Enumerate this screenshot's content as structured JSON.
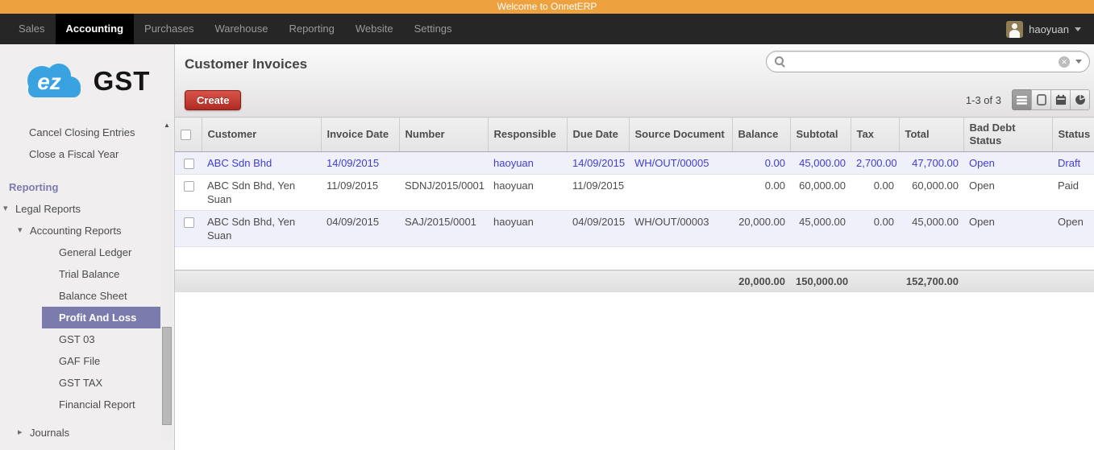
{
  "top_bar": {
    "welcome_text": "Welcome to OnnetERP"
  },
  "nav": {
    "items": [
      {
        "label": "Sales",
        "active": false
      },
      {
        "label": "Accounting",
        "active": true
      },
      {
        "label": "Purchases",
        "active": false
      },
      {
        "label": "Warehouse",
        "active": false
      },
      {
        "label": "Reporting",
        "active": false
      },
      {
        "label": "Website",
        "active": false
      },
      {
        "label": "Settings",
        "active": false
      }
    ],
    "user": {
      "name": "haoyuan"
    }
  },
  "sidebar": {
    "logo": {
      "cloud_text": "ez",
      "brand_text": "GST"
    },
    "items": [
      {
        "label": "Cancel Closing Entries",
        "level": "top",
        "caret": "none",
        "selected": false
      },
      {
        "label": "Close a Fiscal Year",
        "level": "top",
        "caret": "none",
        "selected": false
      },
      {
        "label": "Reporting",
        "level": "section",
        "caret": "none",
        "selected": false
      },
      {
        "label": "Legal Reports",
        "level": "0",
        "caret": "expanded",
        "selected": false
      },
      {
        "label": "Accounting Reports",
        "level": "1",
        "caret": "expanded",
        "selected": false
      },
      {
        "label": "General Ledger",
        "level": "2",
        "caret": "none",
        "selected": false
      },
      {
        "label": "Trial Balance",
        "level": "2",
        "caret": "none",
        "selected": false
      },
      {
        "label": "Balance Sheet",
        "level": "2",
        "caret": "none",
        "selected": false
      },
      {
        "label": "Profit And Loss",
        "level": "2",
        "caret": "none",
        "selected": true
      },
      {
        "label": "GST 03",
        "level": "2",
        "caret": "none",
        "selected": false
      },
      {
        "label": "GAF File",
        "level": "2",
        "caret": "none",
        "selected": false
      },
      {
        "label": "GST TAX",
        "level": "2",
        "caret": "none",
        "selected": false
      },
      {
        "label": "Financial Report",
        "level": "2",
        "caret": "none",
        "selected": false
      },
      {
        "label": "Journals",
        "level": "1",
        "caret": "collapsed",
        "selected": false,
        "gap": true
      }
    ]
  },
  "main": {
    "title": "Customer Invoices",
    "search": {
      "value": "",
      "placeholder": ""
    },
    "create_label": "Create",
    "pagination": "1-3 of 3",
    "view_switcher": [
      {
        "name": "list",
        "active": true
      },
      {
        "name": "form",
        "active": false
      },
      {
        "name": "calendar",
        "active": false
      },
      {
        "name": "graph",
        "active": false
      }
    ],
    "table": {
      "columns": [
        {
          "key": "customer",
          "label": "Customer",
          "numeric": false
        },
        {
          "key": "invoice_date",
          "label": "Invoice Date",
          "numeric": false
        },
        {
          "key": "number",
          "label": "Number",
          "numeric": false
        },
        {
          "key": "responsible",
          "label": "Responsible",
          "numeric": false
        },
        {
          "key": "due_date",
          "label": "Due Date",
          "numeric": false
        },
        {
          "key": "source_document",
          "label": "Source Document",
          "numeric": false
        },
        {
          "key": "balance",
          "label": "Balance",
          "numeric": true
        },
        {
          "key": "subtotal",
          "label": "Subtotal",
          "numeric": true
        },
        {
          "key": "tax",
          "label": "Tax",
          "numeric": true
        },
        {
          "key": "total",
          "label": "Total",
          "numeric": true
        },
        {
          "key": "bad_debt_status",
          "label": "Bad Debt Status",
          "numeric": false
        },
        {
          "key": "status",
          "label": "Status",
          "numeric": false
        }
      ],
      "rows": [
        {
          "customer": "ABC Sdn Bhd",
          "invoice_date": "14/09/2015",
          "number": "",
          "responsible": "haoyuan",
          "due_date": "14/09/2015",
          "source_document": "WH/OUT/00005",
          "balance": "0.00",
          "subtotal": "45,000.00",
          "tax": "2,700.00",
          "total": "47,700.00",
          "bad_debt_status": "Open",
          "status": "Draft",
          "state": "draft"
        },
        {
          "customer": "ABC Sdn Bhd, Yen Suan",
          "invoice_date": "11/09/2015",
          "number": "SDNJ/2015/0001",
          "responsible": "haoyuan",
          "due_date": "11/09/2015",
          "source_document": "",
          "balance": "0.00",
          "subtotal": "60,000.00",
          "tax": "0.00",
          "total": "60,000.00",
          "bad_debt_status": "Open",
          "status": "Paid",
          "state": "paid"
        },
        {
          "customer": "ABC Sdn Bhd, Yen Suan",
          "invoice_date": "04/09/2015",
          "number": "SAJ/2015/0001",
          "responsible": "haoyuan",
          "due_date": "04/09/2015",
          "source_document": "WH/OUT/00003",
          "balance": "20,000.00",
          "subtotal": "45,000.00",
          "tax": "0.00",
          "total": "45,000.00",
          "bad_debt_status": "Open",
          "status": "Open",
          "state": "open"
        }
      ],
      "totals": {
        "balance": "20,000.00",
        "subtotal": "150,000.00",
        "tax": "",
        "total": "152,700.00"
      }
    }
  },
  "colors": {
    "banner_orange": "#EDA23F",
    "navbar_dark": "#262626",
    "active_tab_black": "#000000",
    "sidebar_purple": "#7C7BAD",
    "create_red": "#C03A30",
    "draft_blue": "#3E3ED8",
    "row_stripe": "#F0F0FA",
    "logo_blue": "#39A3E2"
  }
}
